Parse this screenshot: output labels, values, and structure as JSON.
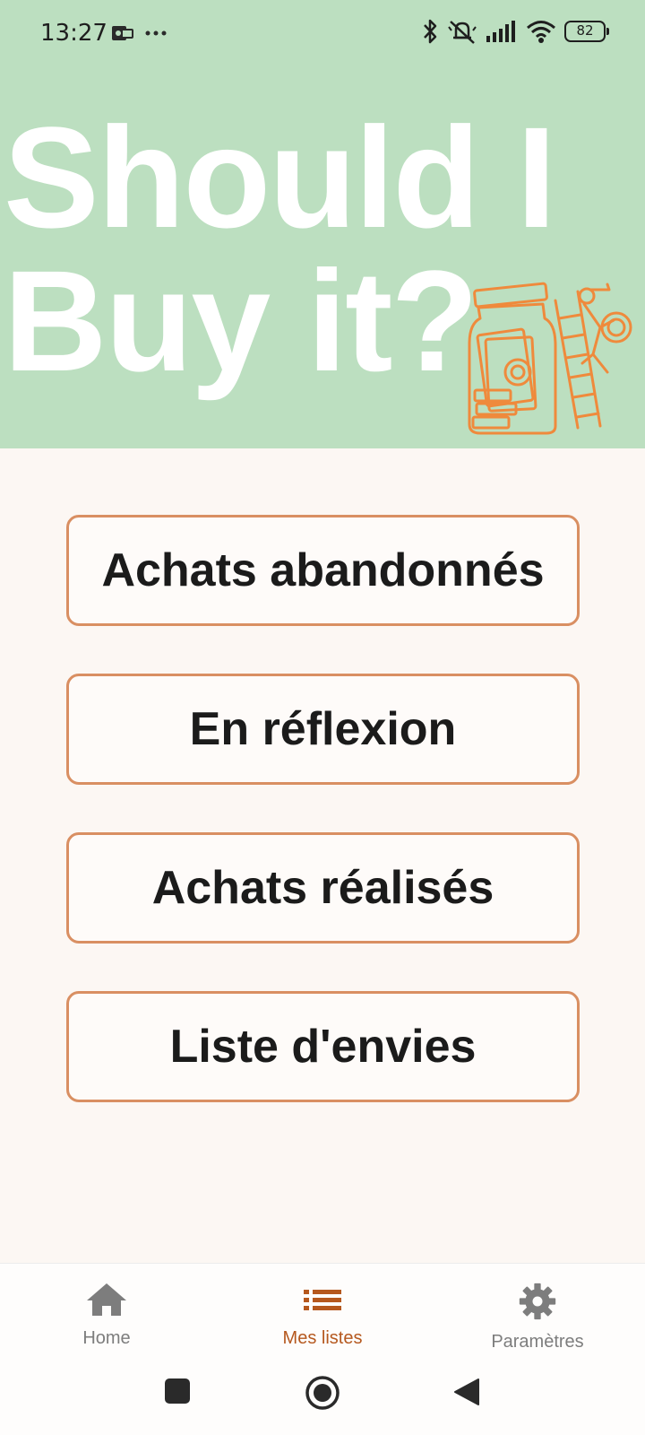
{
  "status_bar": {
    "time": "13:27",
    "battery": "82",
    "icons": [
      "notification-icon",
      "more-dots-icon",
      "bluetooth-icon",
      "mute-icon",
      "signal-icon",
      "wifi-icon",
      "battery-icon"
    ]
  },
  "header": {
    "title_line1": "Should I",
    "title_line2": "Buy it?",
    "illustration": "jar-ladder-icon"
  },
  "menu": {
    "items": [
      {
        "label": "Achats abandonnés"
      },
      {
        "label": "En réflexion"
      },
      {
        "label": "Achats réalisés"
      },
      {
        "label": "Liste d'envies"
      }
    ]
  },
  "bottom_nav": {
    "items": [
      {
        "label": "Home",
        "icon": "home-icon",
        "active": false
      },
      {
        "label": "Mes listes",
        "icon": "list-icon",
        "active": true
      },
      {
        "label": "Paramètres",
        "icon": "gear-icon",
        "active": false
      }
    ]
  },
  "system_nav": {
    "icons": [
      "recents-icon",
      "home-circle-icon",
      "back-icon"
    ]
  },
  "colors": {
    "header_bg": "#bcdfc0",
    "page_bg": "#fcf7f3",
    "accent": "#d98f62",
    "active_nav": "#b5581e",
    "inactive_nav": "#7d7d7d"
  }
}
